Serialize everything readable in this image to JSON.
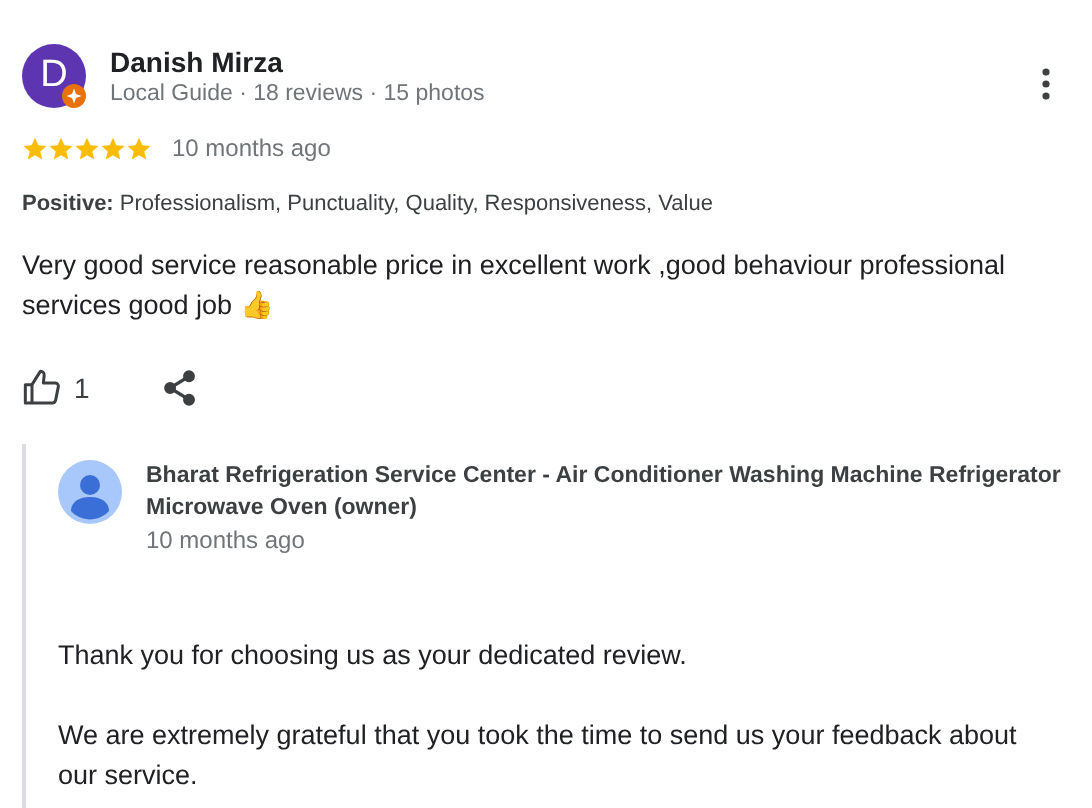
{
  "review": {
    "author": {
      "initial": "D",
      "name": "Danish Mirza",
      "local_guide": true,
      "meta": "Local Guide · 18 reviews · 15 photos"
    },
    "stars": 5,
    "time": "10 months ago",
    "highlights": "**Positive:** Professionalism, Punctuality, Quality, Responsiveness, Value",
    "text": "Very good service reasonable price in excellent work ,good behaviour professional services good job 👍",
    "likes": "1"
  },
  "reply": {
    "author": "Bharat Refrigeration Service Center - Air Conditioner Washing Machine Refrigerator Microwave Oven (owner)",
    "time": "10 months ago",
    "paragraphs": [
      "Thank you for choosing us as your dedicated review.",
      "We are extremely grateful that you took the time to send us your feedback about our service."
    ]
  }
}
